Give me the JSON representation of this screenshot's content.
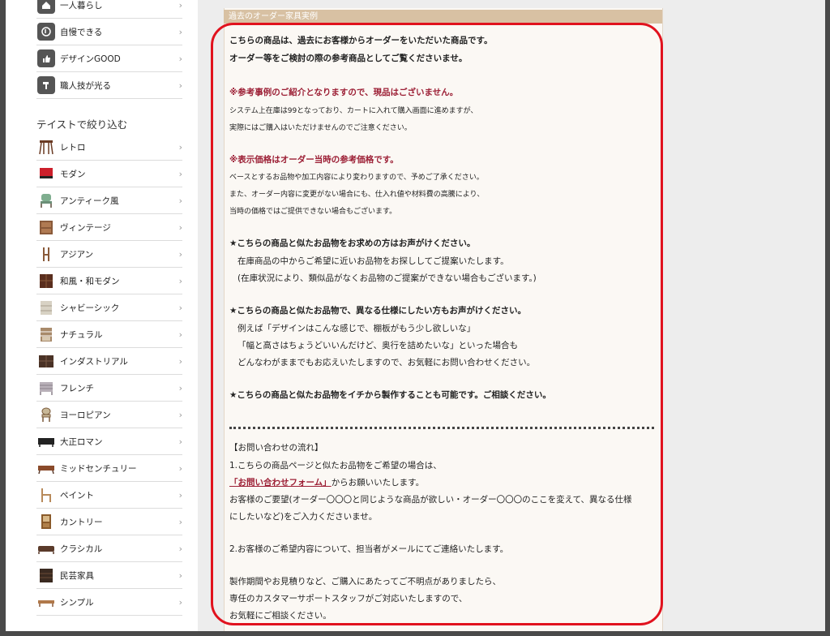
{
  "sidebar": {
    "items_top": [
      {
        "label": "一人暮らし",
        "icon": "home-icon"
      },
      {
        "label": "自慢できる",
        "icon": "music-note-icon"
      },
      {
        "label": "デザインGOOD",
        "icon": "thumbs-up-icon"
      },
      {
        "label": "職人技が光る",
        "icon": "hammer-icon"
      }
    ],
    "taste_heading": "テイストで絞り込む",
    "items_taste": [
      {
        "label": "レトロ",
        "icon": "retro-stool-icon"
      },
      {
        "label": "モダン",
        "icon": "modern-chair-icon"
      },
      {
        "label": "アンティーク風",
        "icon": "antique-chair-icon"
      },
      {
        "label": "ヴィンテージ",
        "icon": "vintage-cabinet-icon"
      },
      {
        "label": "アジアン",
        "icon": "asian-chair-icon"
      },
      {
        "label": "和風・和モダン",
        "icon": "japanese-cabinet-icon"
      },
      {
        "label": "シャビーシック",
        "icon": "shabby-chic-shelf-icon"
      },
      {
        "label": "ナチュラル",
        "icon": "natural-shelf-icon"
      },
      {
        "label": "インダストリアル",
        "icon": "industrial-cabinet-icon"
      },
      {
        "label": "フレンチ",
        "icon": "french-dresser-icon"
      },
      {
        "label": "ヨーロピアン",
        "icon": "european-chair-icon"
      },
      {
        "label": "大正ロマン",
        "icon": "taisho-sofa-icon"
      },
      {
        "label": "ミッドセンチュリー",
        "icon": "midcentury-sideboard-icon"
      },
      {
        "label": "ペイント",
        "icon": "paint-chair-icon"
      },
      {
        "label": "カントリー",
        "icon": "country-cupboard-icon"
      },
      {
        "label": "クラシカル",
        "icon": "classical-sofa-icon"
      },
      {
        "label": "民芸家具",
        "icon": "folk-cabinet-icon"
      },
      {
        "label": "シンプル",
        "icon": "simple-bench-icon"
      }
    ]
  },
  "main": {
    "panel_title": "過去のオーダー家具実例",
    "intro_1": "こちらの商品は、過去にお客様からオーダーをいただいた商品です。",
    "intro_2": "オーダー等をご検討の際の参考商品としてご覧くださいませ。",
    "note1_title": "※参考事例のご紹介となりますので、現品はございません。",
    "note1_line1": "システム上在庫は99となっており、カートに入れて購入画面に進めますが、",
    "note1_line2": "実際にはご購入はいただけませんのでご注意ください。",
    "note2_title": "※表示価格はオーダー当時の参考価格です。",
    "note2_line1": "ベースとするお品物や加工内容により変わりますので、予めご了承ください。",
    "note2_line2": "また、オーダー内容に変更がない場合にも、仕入れ値や材料費の高騰により、",
    "note2_line3": "当時の価格ではご提供できない場合もございます。",
    "star1_title": "★こちらの商品と似たお品物をお求めの方はお声がけください。",
    "star1_line1": "在庫商品の中からご希望に近いお品物をお探ししてご提案いたします。",
    "star1_line2": "(在庫状況により、類似品がなくお品物のご提案ができない場合もございます。)",
    "star2_title": "★こちらの商品と似たお品物で、異なる仕様にしたい方もお声がけください。",
    "star2_line1": "例えば「デザインはこんな感じで、棚板がもう少し欲しいな」",
    "star2_line2": "「幅と高さはちょうどいいんだけど、奥行を詰めたいな」といった場合も",
    "star2_line3": "どんなわがままでもお応えいたしますので、お気軽にお問い合わせください。",
    "star3_title": "★こちらの商品と似たお品物をイチから製作することも可能です。ご相談ください。",
    "flow_heading": "【お問い合わせの流れ】",
    "flow_1": "1.こちらの商品ページと似たお品物をご希望の場合は、",
    "flow_link": "「お問い合わせフォーム」",
    "flow_link_after": "からお願いいたします。",
    "flow_req_1": "お客様のご要望(オーダー〇〇〇と同じような商品が欲しい・オーダー〇〇〇のここを変えて、異なる仕様",
    "flow_req_2": "にしたいなど)をご入力くださいませ。",
    "flow_2": "2.お客様のご希望内容について、担当者がメールにてご連絡いたします。",
    "closing_1": "製作期間やお見積りなど、ご購入にあたってご不明点がありましたら、",
    "closing_2": "専任のカスタマーサポートスタッフがご対応いたしますので、",
    "closing_3": "お気軽にご相談ください。"
  }
}
